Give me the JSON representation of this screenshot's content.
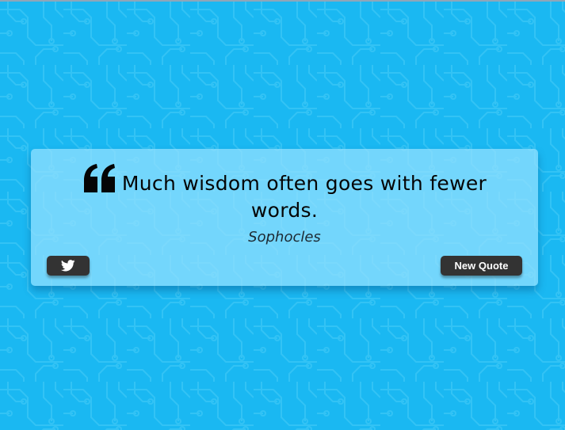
{
  "quote": {
    "text": "Much wisdom often goes with fewer words.",
    "author": "Sophocles"
  },
  "actions": {
    "tweet_icon": "twitter-icon",
    "new_quote_label": "New Quote"
  },
  "icons": {
    "quote_mark": "quote-left-icon"
  },
  "colors": {
    "background": "#1ab8f2",
    "card": "#96e2ff",
    "button": "#333333",
    "button_text": "#ffffff",
    "quote_text": "#050505"
  }
}
